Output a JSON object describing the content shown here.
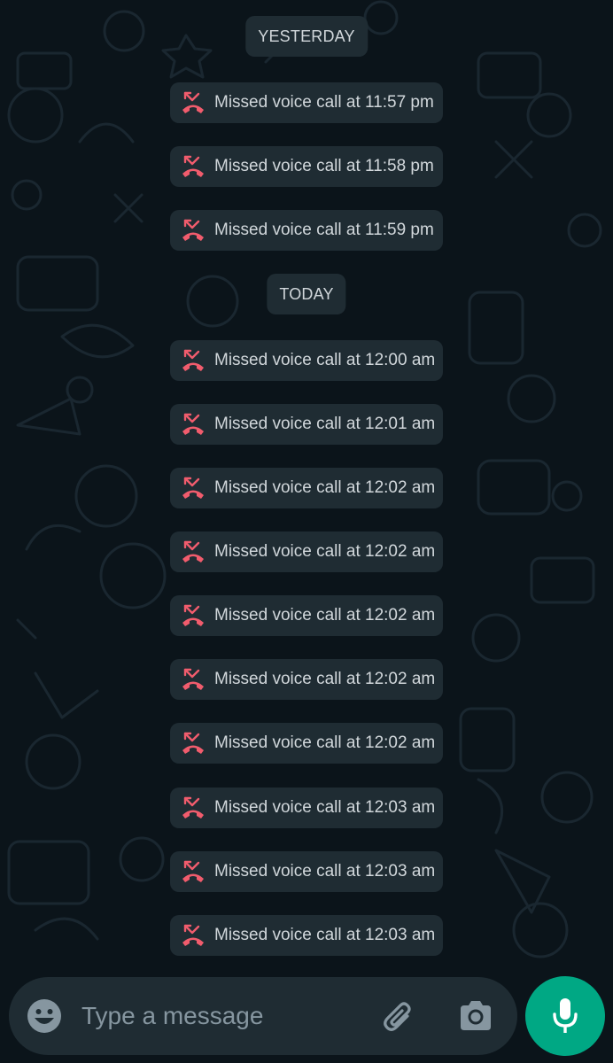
{
  "chat": {
    "date_yesterday": "YESTERDAY",
    "date_today": "TODAY",
    "calls_yesterday": [
      "Missed voice call at 11:57 pm",
      "Missed voice call at 11:58 pm",
      "Missed voice call at 11:59 pm"
    ],
    "calls_today": [
      "Missed voice call at 12:00 am",
      "Missed voice call at 12:01 am",
      "Missed voice call at 12:02 am",
      "Missed voice call at 12:02 am",
      "Missed voice call at 12:02 am",
      "Missed voice call at 12:02 am",
      "Missed voice call at 12:02 am",
      "Missed voice call at 12:03 am",
      "Missed voice call at 12:03 am",
      "Missed voice call at 12:03 am"
    ]
  },
  "composer": {
    "placeholder": "Type a message",
    "icons": [
      "emoji-icon",
      "attach-icon",
      "camera-icon",
      "microphone-icon"
    ]
  },
  "colors": {
    "background": "#0b141a",
    "bubble": "#1f2c33",
    "text": "#d1d7db",
    "missed_icon": "#f15c6d",
    "accent": "#00a884",
    "placeholder": "#8696a0"
  }
}
